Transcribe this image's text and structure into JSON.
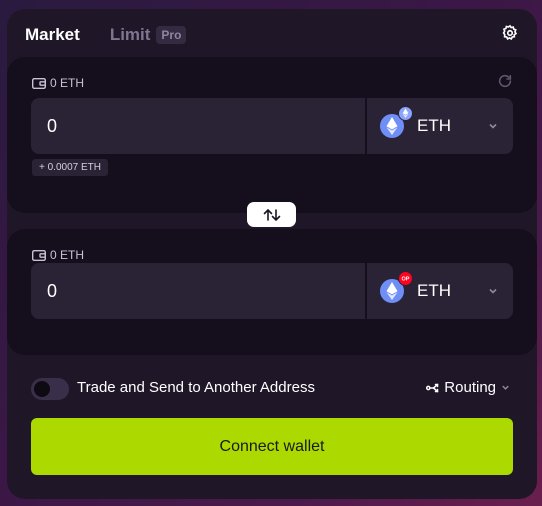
{
  "tabs": {
    "market": "Market",
    "limit": "Limit",
    "pro_badge": "Pro"
  },
  "from": {
    "balance": "0 ETH",
    "amount": "0",
    "token": "ETH",
    "fee": "+ 0.0007 ETH"
  },
  "to": {
    "balance": "0 ETH",
    "amount": "0",
    "token": "ETH",
    "badge": "OP"
  },
  "options": {
    "trade_send_label": "Trade and Send to Another Address",
    "trade_send_enabled": false,
    "routing_label": "Routing"
  },
  "connect_label": "Connect wallet",
  "colors": {
    "accent": "#acd900",
    "eth_blue": "#6f8ff7",
    "op_red": "#ff0420"
  },
  "icons": [
    "gear-icon",
    "wallet-icon",
    "refresh-icon",
    "eth-icon",
    "chevron-down-icon",
    "swap-arrows-icon",
    "routing-icon"
  ]
}
